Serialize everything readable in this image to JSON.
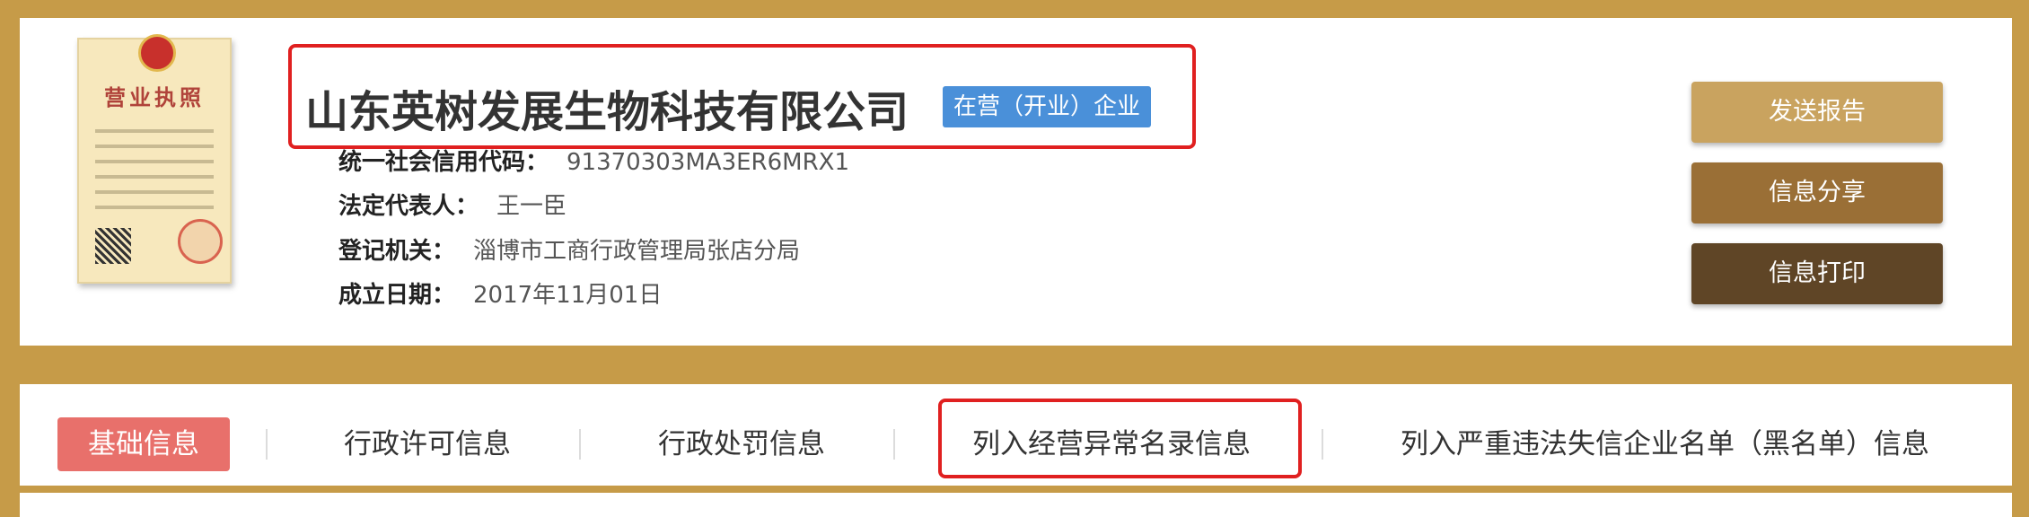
{
  "license": {
    "title": "营业执照"
  },
  "company": {
    "name": "山东英树发展生物科技有限公司",
    "status": "在营（开业）企业"
  },
  "info": [
    {
      "label": "统一社会信用代码：",
      "value": "91370303MA3ER6MRX1"
    },
    {
      "label": "法定代表人：",
      "value": "王一臣"
    },
    {
      "label": "登记机关：",
      "value": "淄博市工商行政管理局张店分局"
    },
    {
      "label": "成立日期：",
      "value": "2017年11月01日"
    }
  ],
  "actions": {
    "send_report": "发送报告",
    "share_info": "信息分享",
    "print_info": "信息打印"
  },
  "tabs": [
    {
      "label": "基础信息",
      "active": true
    },
    {
      "label": "行政许可信息",
      "active": false
    },
    {
      "label": "行政处罚信息",
      "active": false
    },
    {
      "label": "列入经营异常名录信息",
      "active": false
    },
    {
      "label": "列入严重违法失信企业名单（黑名单）信息",
      "active": false
    }
  ],
  "colors": {
    "frame": "#c69b48",
    "badge": "#4a90d9",
    "active_tab": "#e8706b",
    "highlight": "#e02020",
    "btn_send": "#c9a35f",
    "btn_share": "#9a6f36",
    "btn_print": "#5f4526"
  }
}
